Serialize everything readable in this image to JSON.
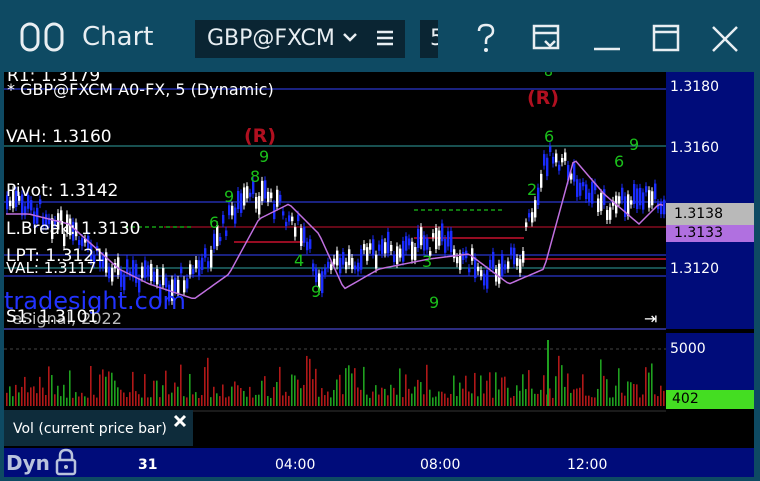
{
  "window": {
    "title": "Chart",
    "symbol_value": "GBP@FXCM",
    "second_box_partial": "5"
  },
  "plot": {
    "header": "* GBP@FXCM A0-FX, 5 (Dynamic)",
    "r1_partial": "R1: 1.3179",
    "vah": "VAH: 1.3160",
    "pivot": "Pivot: 1.3142",
    "lbreak": "L.Break: 1.3130",
    "lpt": "LPT: 1.3121",
    "val_partial": "VAL: 1.3117",
    "s1": "S1: 1.3101",
    "watermark": "tradesight.com",
    "copyright": "eSignal, 2022",
    "r_marker": "(R)"
  },
  "price_axis": {
    "ticks": [
      "1.3180",
      "1.3160",
      "1.3120"
    ],
    "current_price": "1.3138",
    "ma_price": "1.3133"
  },
  "volume": {
    "tick": "5000",
    "current": "402",
    "legend": "Vol (current price bar)"
  },
  "time_axis": {
    "mode": "Dyn",
    "labels": [
      "31",
      "04:00",
      "08:00",
      "12:00"
    ]
  },
  "colors": {
    "frame": "#0e4a63",
    "axis_bg": "#000c7a",
    "up_bar": "#ffffff",
    "down_bar": "#1a2cff",
    "pivot_red": "#c8102e",
    "ma_purple": "#c070e0",
    "vol_green": "#44dd22",
    "signal_green": "#1bbf1b"
  }
}
